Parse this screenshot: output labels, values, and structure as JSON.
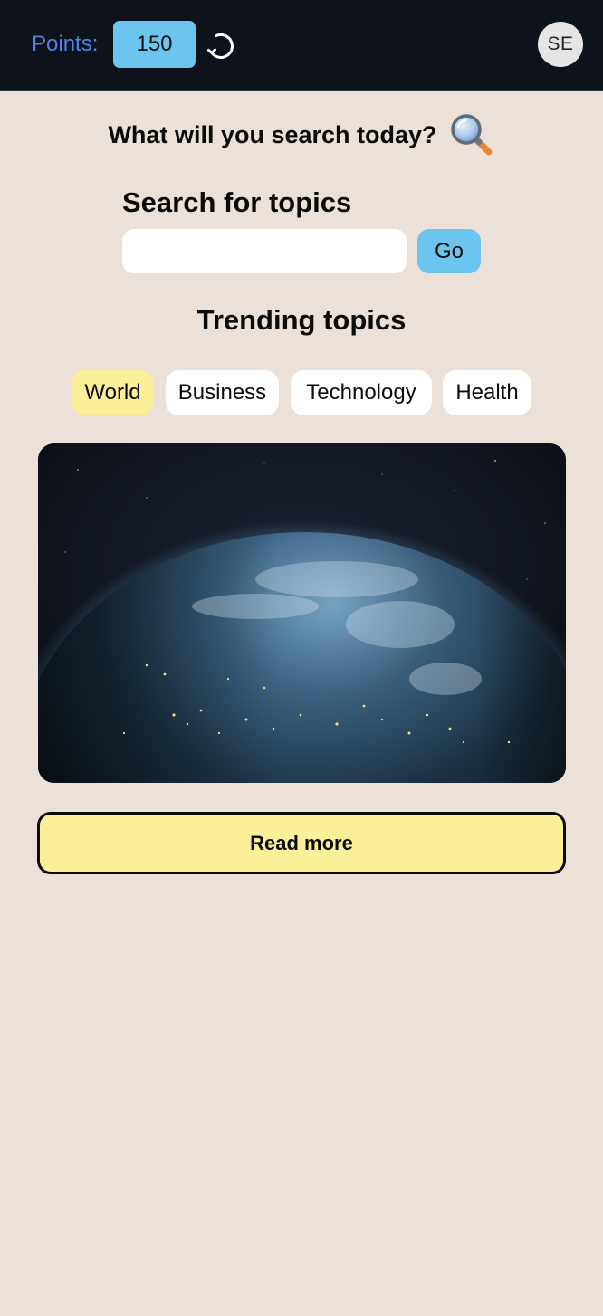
{
  "header": {
    "points_label": "Points:",
    "points_value": "150",
    "avatar_initials": "SE"
  },
  "greeting": {
    "text": "What will you search today?",
    "icon": "magnifying-glass-icon"
  },
  "search": {
    "title": "Search for topics",
    "placeholder": "",
    "value": "",
    "go_label": "Go"
  },
  "trending": {
    "title": "Trending topics",
    "topics": [
      {
        "label": "World",
        "active": true
      },
      {
        "label": "Business",
        "active": false
      },
      {
        "label": "Technology",
        "active": false
      },
      {
        "label": "Health",
        "active": false
      }
    ]
  },
  "hero": {
    "image": "earth-at-night-from-space"
  },
  "actions": {
    "read_more_label": "Read more"
  },
  "colors": {
    "header_bg": "#0e131b",
    "page_bg": "#ebe1d8",
    "accent_blue": "#6cc5ee",
    "points_label": "#4f83e6",
    "highlight_yellow": "#fcef99"
  }
}
